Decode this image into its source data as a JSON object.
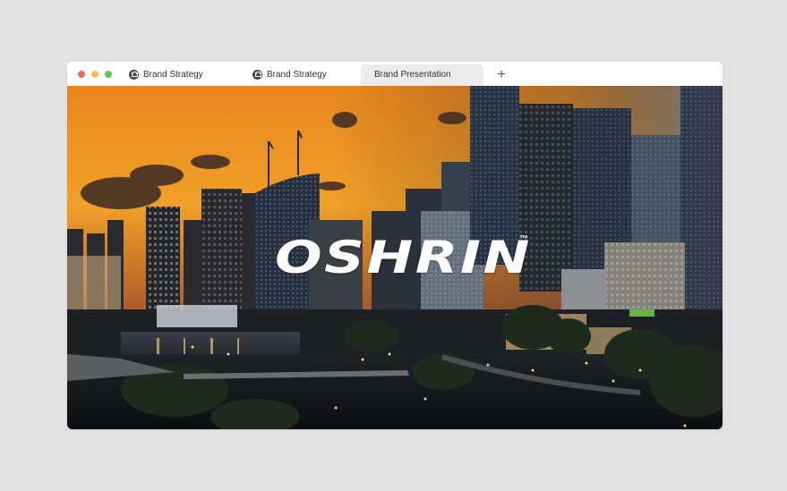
{
  "window": {
    "controls": {
      "close_color": "#ee6a5f",
      "minimize_color": "#f5be4f",
      "maximize_color": "#62c655"
    },
    "tabs": [
      {
        "label": "Brand Strategy",
        "icon": "brand-favicon-icon",
        "active": false
      },
      {
        "label": "Brand Strategy",
        "icon": "brand-favicon-icon",
        "active": false
      },
      {
        "label": "Brand Presentation",
        "active": true
      }
    ],
    "new_tab_label": "+"
  },
  "hero": {
    "logo_text": "OSHRIN",
    "trademark": "™",
    "image": "city-skyline-at-sunset"
  }
}
